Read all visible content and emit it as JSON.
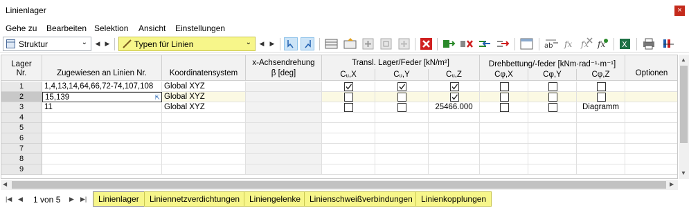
{
  "window": {
    "title": "Linienlager",
    "close": "×"
  },
  "menu": [
    "Gehe zu",
    "Bearbeiten",
    "Selektion",
    "Ansicht",
    "Einstellungen"
  ],
  "toolbar": {
    "combo1": "Struktur",
    "combo2": "Typen für Linien"
  },
  "headers": {
    "lager": "Lager",
    "nr": "Nr.",
    "zugewiesen": "Zugewiesen an Linien Nr.",
    "koordsys": "Koordinatensystem",
    "xachs1": "x-Achsendrehung",
    "xachs2": "β [deg]",
    "transl": "Transl. Lager/Feder [kN/m²]",
    "drehb": "Drehbettung/-feder [kNm·rad⁻¹·m⁻¹]",
    "cux": "Cᵤ,X",
    "cuy": "Cᵤ,Y",
    "cuz": "Cᵤ,Z",
    "cpx": "Cφ,X",
    "cpy": "Cφ,Y",
    "cpz": "Cφ,Z",
    "optionen": "Optionen"
  },
  "rows": [
    {
      "nr": "1",
      "lines": "1,4,13,14,64,66,72-74,107,108",
      "koord": "Global XYZ",
      "cux": true,
      "cuy": true,
      "cuz": true,
      "cpx": false,
      "cpy": false,
      "cpz": false,
      "cuz_text": "",
      "cpz_text": ""
    },
    {
      "nr": "2",
      "lines": "15,139",
      "koord": "Global XYZ",
      "cux": false,
      "cuy": false,
      "cuz": true,
      "cpx": false,
      "cpy": false,
      "cpz": false,
      "cuz_text": "",
      "cpz_text": ""
    },
    {
      "nr": "3",
      "lines": "11",
      "koord": "Global XYZ",
      "cux": false,
      "cuy": false,
      "cuz": null,
      "cpx": false,
      "cpy": false,
      "cpz": null,
      "cuz_text": "25466.000",
      "cpz_text": "Diagramm"
    },
    {
      "nr": "4"
    },
    {
      "nr": "5"
    },
    {
      "nr": "6"
    },
    {
      "nr": "7"
    },
    {
      "nr": "8"
    },
    {
      "nr": "9"
    }
  ],
  "pager": {
    "text": "1 von 5"
  },
  "tabs": [
    "Linienlager",
    "Liniennetzverdichtungen",
    "Liniengelenke",
    "Linienschweißverbindungen",
    "Linienkopplungen"
  ]
}
